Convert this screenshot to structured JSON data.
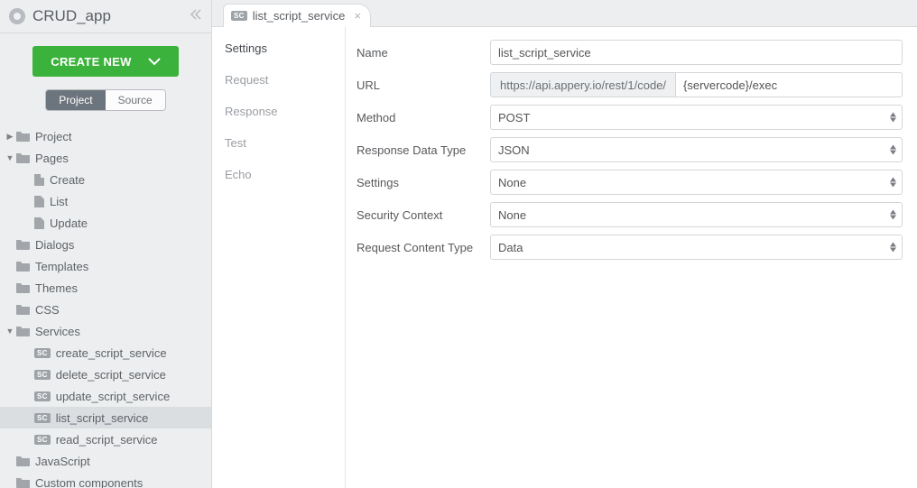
{
  "sidebar": {
    "app_name": "CRUD_app",
    "create_new": "CREATE NEW",
    "toggle": {
      "project": "Project",
      "source": "Source"
    },
    "tree": {
      "project": "Project",
      "pages": "Pages",
      "create": "Create",
      "list": "List",
      "update": "Update",
      "dialogs": "Dialogs",
      "templates": "Templates",
      "themes": "Themes",
      "css": "CSS",
      "services": "Services",
      "svc_create": "create_script_service",
      "svc_delete": "delete_script_service",
      "svc_update": "update_script_service",
      "svc_list": "list_script_service",
      "svc_read": "read_script_service",
      "javascript": "JavaScript",
      "custom_components": "Custom components"
    }
  },
  "tab": {
    "badge": "SC",
    "title": "list_script_service"
  },
  "subnav": {
    "settings": "Settings",
    "request": "Request",
    "response": "Response",
    "test": "Test",
    "echo": "Echo"
  },
  "form": {
    "name_label": "Name",
    "name_value": "list_script_service",
    "url_label": "URL",
    "url_prefix": "https://api.appery.io/rest/1/code/",
    "url_value": "{servercode}/exec",
    "method_label": "Method",
    "method_value": "POST",
    "rdt_label": "Response Data Type",
    "rdt_value": "JSON",
    "settings_label": "Settings",
    "settings_value": "None",
    "security_label": "Security Context",
    "security_value": "None",
    "rct_label": "Request Content Type",
    "rct_value": "Data"
  }
}
